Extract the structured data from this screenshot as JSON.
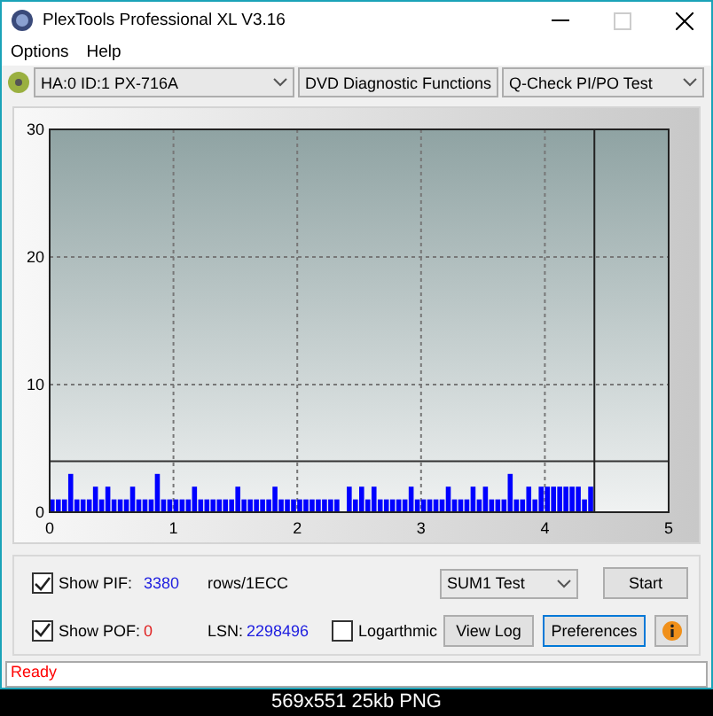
{
  "window": {
    "title": "PlexTools Professional XL V3.16"
  },
  "menu": [
    {
      "label": "Options"
    },
    {
      "label": "Help"
    }
  ],
  "toolbar": {
    "drive": "HA:0 ID:1  PX-716A",
    "function": "DVD Diagnostic Functions",
    "test": "Q-Check PI/PO Test"
  },
  "chart": {
    "chart_data": {
      "type": "bar",
      "xlim": [
        0,
        5
      ],
      "ylim": [
        0,
        30
      ],
      "xticks": [
        0,
        1,
        2,
        3,
        4,
        5
      ],
      "yticks": [
        0,
        10,
        20,
        30
      ],
      "x": [
        0,
        0.05,
        0.1,
        0.15,
        0.2,
        0.25,
        0.3,
        0.35,
        0.4,
        0.45,
        0.5,
        0.55,
        0.6,
        0.65,
        0.7,
        0.75,
        0.8,
        0.85,
        0.9,
        0.95,
        1,
        1.05,
        1.1,
        1.15,
        1.2,
        1.25,
        1.3,
        1.35,
        1.4,
        1.45,
        1.5,
        1.55,
        1.6,
        1.65,
        1.7,
        1.75,
        1.8,
        1.85,
        1.9,
        1.95,
        2,
        2.05,
        2.1,
        2.15,
        2.2,
        2.25,
        2.3,
        2.35,
        2.4,
        2.45,
        2.5,
        2.55,
        2.6,
        2.65,
        2.7,
        2.75,
        2.8,
        2.85,
        2.9,
        2.95,
        3,
        3.05,
        3.1,
        3.15,
        3.2,
        3.25,
        3.3,
        3.35,
        3.4,
        3.45,
        3.5,
        3.55,
        3.6,
        3.65,
        3.7,
        3.75,
        3.8,
        3.85,
        3.9,
        3.95,
        4,
        4.05,
        4.1,
        4.15,
        4.2,
        4.25,
        4.3,
        4.35
      ],
      "series": [
        {
          "color": "#0000ff",
          "values": [
            1,
            1,
            1,
            3,
            1,
            1,
            1,
            2,
            1,
            2,
            1,
            1,
            1,
            2,
            1,
            1,
            1,
            3,
            1,
            1,
            1,
            1,
            1,
            2,
            1,
            1,
            1,
            1,
            1,
            1,
            2,
            1,
            1,
            1,
            1,
            1,
            2,
            1,
            1,
            1,
            1,
            1,
            1,
            1,
            1,
            1,
            1,
            0,
            2,
            1,
            2,
            1,
            2,
            1,
            1,
            1,
            1,
            1,
            2,
            1,
            1,
            1,
            1,
            1,
            2,
            1,
            1,
            1,
            2,
            1,
            2,
            1,
            1,
            1,
            3,
            1,
            1,
            2,
            1,
            2,
            2,
            2,
            2,
            2,
            2,
            2,
            1,
            2
          ]
        }
      ],
      "grid": true,
      "ref_lines": [
        {
          "axis": "y",
          "value": 4
        },
        {
          "axis": "x",
          "value": 4.4
        }
      ]
    }
  },
  "controls": {
    "show_pif": {
      "label": "Show PIF:",
      "checked": true,
      "value": "3380",
      "unit": "rows/1ECC"
    },
    "show_pof": {
      "label": "Show POF:",
      "checked": true,
      "value": "0"
    },
    "lsn": {
      "label": "LSN:",
      "value": "2298496"
    },
    "logarithmic": {
      "label": "Logarthmic",
      "checked": false
    },
    "test_select": "SUM1 Test",
    "buttons": [
      {
        "label": "Start",
        "kind": "plain",
        "focused": false
      },
      {
        "label": "View Log",
        "kind": "plain",
        "focused": false
      },
      {
        "label": "Preferences",
        "kind": "plain",
        "focused": true
      },
      {
        "kind": "info"
      }
    ]
  },
  "status_bar": {
    "text": "Ready"
  },
  "caption": "569x551 25kb PNG"
}
